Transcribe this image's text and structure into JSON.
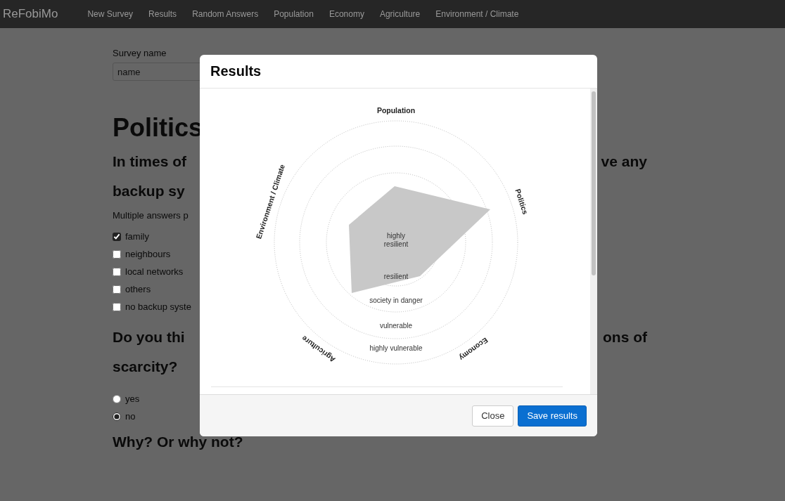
{
  "navbar": {
    "brand": "ReFobiMo",
    "items": [
      {
        "label": "New Survey"
      },
      {
        "label": "Results"
      },
      {
        "label": "Random Answers"
      },
      {
        "label": "Population"
      },
      {
        "label": "Economy"
      },
      {
        "label": "Agriculture"
      },
      {
        "label": "Environment / Climate"
      }
    ]
  },
  "page": {
    "survey_label": "Survey name",
    "survey_placeholder": "name",
    "section_title": "Politics",
    "question_1": {
      "lines": [
        {
          "left": "In times of",
          "right": "ve any"
        },
        {
          "left": "backup sy"
        }
      ],
      "hint": "Multiple answers p",
      "options": [
        {
          "label": "family",
          "checked": true
        },
        {
          "label": "neighbours",
          "checked": false
        },
        {
          "label": "local networks",
          "checked": false
        },
        {
          "label": "others",
          "checked": false
        },
        {
          "label": "no backup syste",
          "checked": false
        }
      ]
    },
    "question_2": {
      "lines": [
        {
          "left": "Do you thi",
          "right": "ons of"
        },
        {
          "left": "scarcity?"
        }
      ],
      "options": [
        {
          "label": "yes",
          "selected": false
        },
        {
          "label": "no",
          "selected": true
        }
      ]
    },
    "question_3": "Why? Or why not?"
  },
  "modal": {
    "title": "Results",
    "chart": {
      "axes": [
        "Population",
        "Politics",
        "Economy",
        "Agriculture",
        "Environment / Climate"
      ],
      "zones": [
        "highly resilient",
        "resilient",
        "society in danger",
        "vulnerable",
        "highly vulnerable"
      ]
    },
    "buttons": [
      {
        "label": "Close",
        "kind": "default"
      },
      {
        "label": "Save results",
        "kind": "primary"
      }
    ]
  }
}
